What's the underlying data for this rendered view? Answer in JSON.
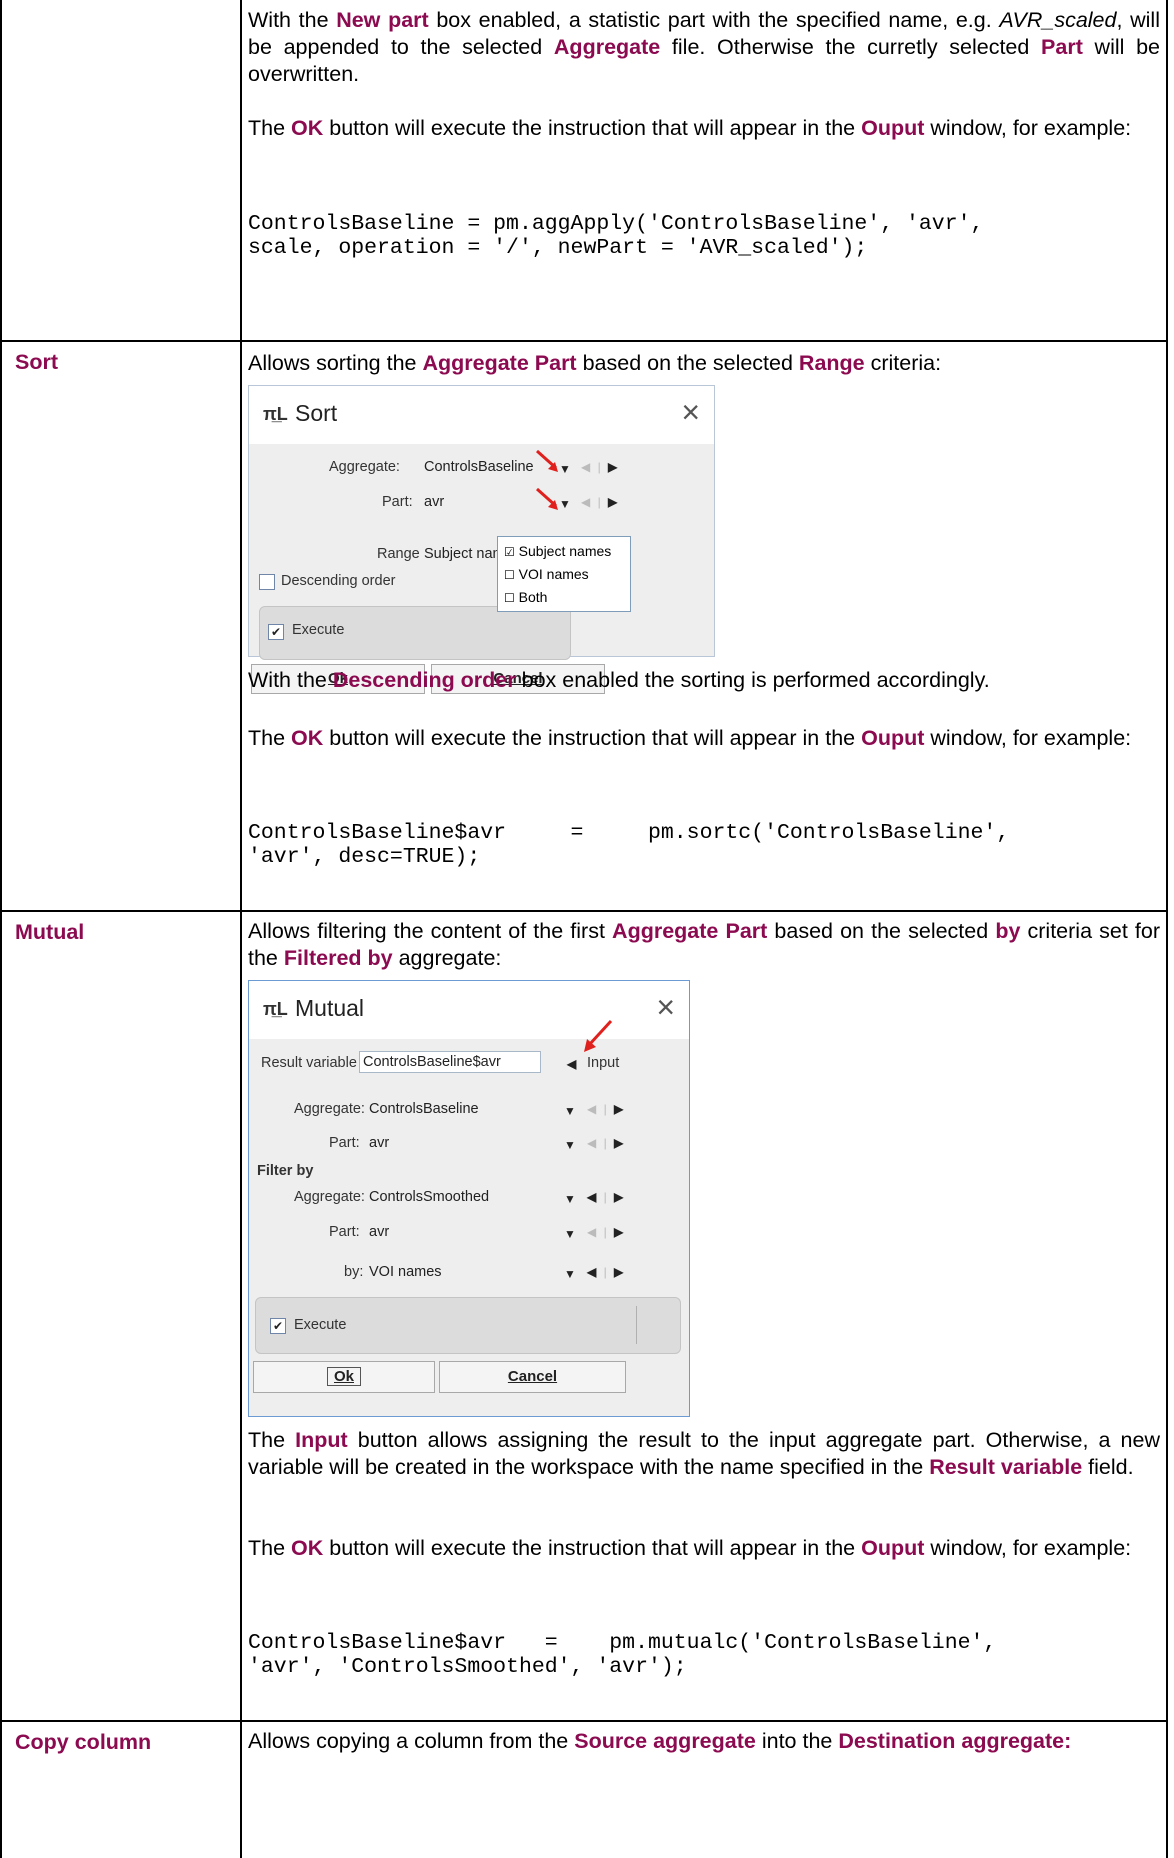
{
  "colors": {
    "keyword": "#8b0a50",
    "border": "#000000",
    "dialog_bg": "#eeeeee",
    "red_marker": "#e0201c"
  },
  "row_top": {
    "p1_a": "With the ",
    "p1_new_part": "New part",
    "p1_b": " box enabled, a statistic part with the specified name, e.g. ",
    "p1_avr_scaled": "AVR_scaled",
    "p1_c": ", will be appended to the selected ",
    "p1_aggregate": "Aggregate",
    "p1_d": " file. Otherwise the curretly selected ",
    "p1_part": "Part",
    "p1_e": " will be overwritten.",
    "p2_a": "The ",
    "p2_ok": "OK",
    "p2_b": " button will execute the instruction that will appear in the ",
    "p2_ouput": "Ouput",
    "p2_c": " window, for example:",
    "code_line1": "ControlsBaseline = pm.aggApply('ControlsBaseline', 'avr',",
    "code_line2": "scale, operation = '/', newPart = 'AVR_scaled');"
  },
  "row_sort": {
    "label": "Sort",
    "intro_a": "Allows sorting the ",
    "intro_agg_part": "Aggregate Part",
    "intro_b": " based on the selected ",
    "intro_range": "Range",
    "intro_c": " criteria:",
    "dialog": {
      "icon": "π̲L",
      "title": "Sort",
      "close": "×",
      "aggregate_label": "Aggregate:",
      "aggregate_value": "ControlsBaseline",
      "part_label": "Part:",
      "part_value": "avr",
      "range_label": "Range",
      "range_value": "Subject names",
      "descending_label": "Descending order",
      "execute_label": "Execute",
      "ok_button": "Ok",
      "cancel_button": "Cancel",
      "dropdown_options": [
        "Subject names",
        "VOI names",
        "Both"
      ],
      "dropdown_checked": [
        true,
        false,
        false
      ]
    },
    "p1_a": "With the ",
    "p1_desc": "Descending order",
    "p1_b": " box enabled the sorting is performed accordingly.",
    "p2_a": "The ",
    "p2_ok": "OK",
    "p2_b": " button will execute the instruction that will appear in the ",
    "p2_ouput": "Ouput",
    "p2_c": " window, for example:",
    "code_line1": "ControlsBaseline$avr     =     pm.sortc('ControlsBaseline',",
    "code_line2": "'avr', desc=TRUE);"
  },
  "row_mutual": {
    "label": "Mutual",
    "intro_a": "Allows filtering the content of the first ",
    "intro_agg_part": "Aggregate Part",
    "intro_b": " based on the selected ",
    "intro_by": "by",
    "intro_c": " criteria set for the ",
    "intro_filtered": "Filtered by",
    "intro_d": " aggregate:",
    "dialog": {
      "icon": "π̲L",
      "title": "Mutual",
      "close": "×",
      "result_label": "Result variable",
      "result_value": "ControlsBaseline$avr",
      "input_button": "Input",
      "aggregate_label": "Aggregate:",
      "aggregate_value": "ControlsBaseline",
      "part_label": "Part:",
      "part_value": "avr",
      "filter_by_label": "Filter by",
      "filter_aggregate_label": "Aggregate:",
      "filter_aggregate_value": "ControlsSmoothed",
      "filter_part_label": "Part:",
      "filter_part_value": "avr",
      "by_label": "by:",
      "by_value": "VOI names",
      "execute_label": "Execute",
      "ok_button": "Ok",
      "cancel_button": "Cancel"
    },
    "p1_a": "The ",
    "p1_input": "Input",
    "p1_b": " button allows assigning the result  to the input aggregate part. Otherwise, a new variable will be created in the workspace with the name specified in the ",
    "p1_result": "Result variable",
    "p1_c": " field.",
    "p2_a": "The ",
    "p2_ok": "OK",
    "p2_b": " button will execute the instruction that will appear in the ",
    "p2_ouput": "Ouput",
    "p2_c": " window, for example:",
    "code_line1": "ControlsBaseline$avr   =    pm.mutualc('ControlsBaseline',",
    "code_line2": "'avr', 'ControlsSmoothed', 'avr');"
  },
  "row_copy": {
    "label": "Copy column",
    "intro_a": "Allows copying a column from the ",
    "intro_source": "Source aggregate",
    "intro_b": " into the ",
    "intro_dest": "Destination aggregate:"
  }
}
